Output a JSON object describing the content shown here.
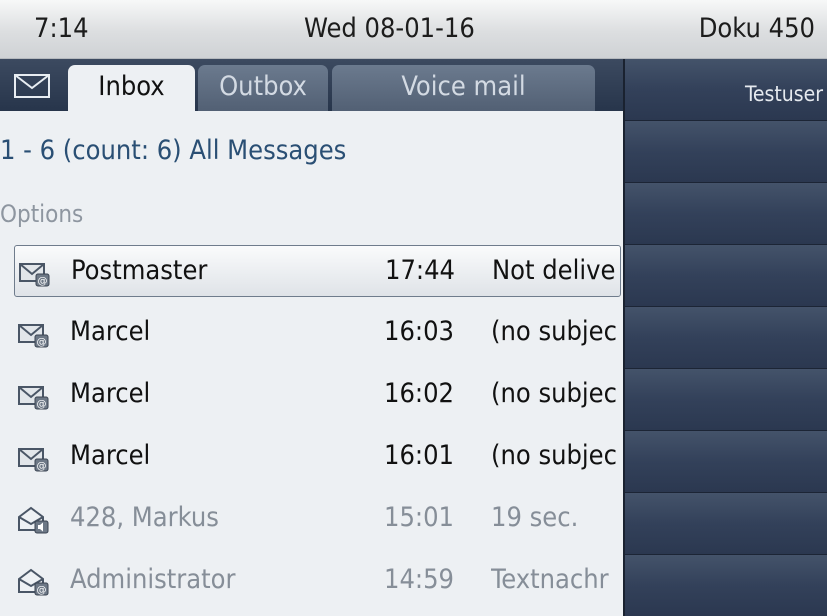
{
  "status_bar": {
    "time": "7:14",
    "date": "Wed 08-01-16",
    "device": "Doku 450"
  },
  "tabs": [
    {
      "label": "Inbox",
      "active": true
    },
    {
      "label": "Outbox",
      "active": false
    },
    {
      "label": "Voice mail",
      "active": false
    }
  ],
  "list_header": {
    "count_line": "1 - 6 (count: 6) All Messages",
    "options_label": "Options"
  },
  "messages": [
    {
      "sender": "Postmaster",
      "time": "17:44",
      "subject": "Not delive",
      "icon": "email-unread-icon",
      "read": false
    },
    {
      "sender": "Marcel",
      "time": "16:03",
      "subject": "(no subjec",
      "icon": "email-unread-icon",
      "read": false
    },
    {
      "sender": "Marcel",
      "time": "16:02",
      "subject": "(no subjec",
      "icon": "email-unread-icon",
      "read": false
    },
    {
      "sender": "Marcel",
      "time": "16:01",
      "subject": "(no subjec",
      "icon": "email-unread-icon",
      "read": false
    },
    {
      "sender": "428, Markus",
      "time": "15:01",
      "subject": "19 sec.",
      "icon": "voicemail-read-icon",
      "read": true
    },
    {
      "sender": "Administrator",
      "time": "14:59",
      "subject": "Textnachr",
      "icon": "email-read-icon",
      "read": true
    }
  ],
  "softkeys": [
    {
      "label": "Testuser"
    }
  ],
  "colors": {
    "accent_text": "#2a4f74",
    "tab_bar": "#2e3c52",
    "right_panel": "#2e3a4e"
  }
}
